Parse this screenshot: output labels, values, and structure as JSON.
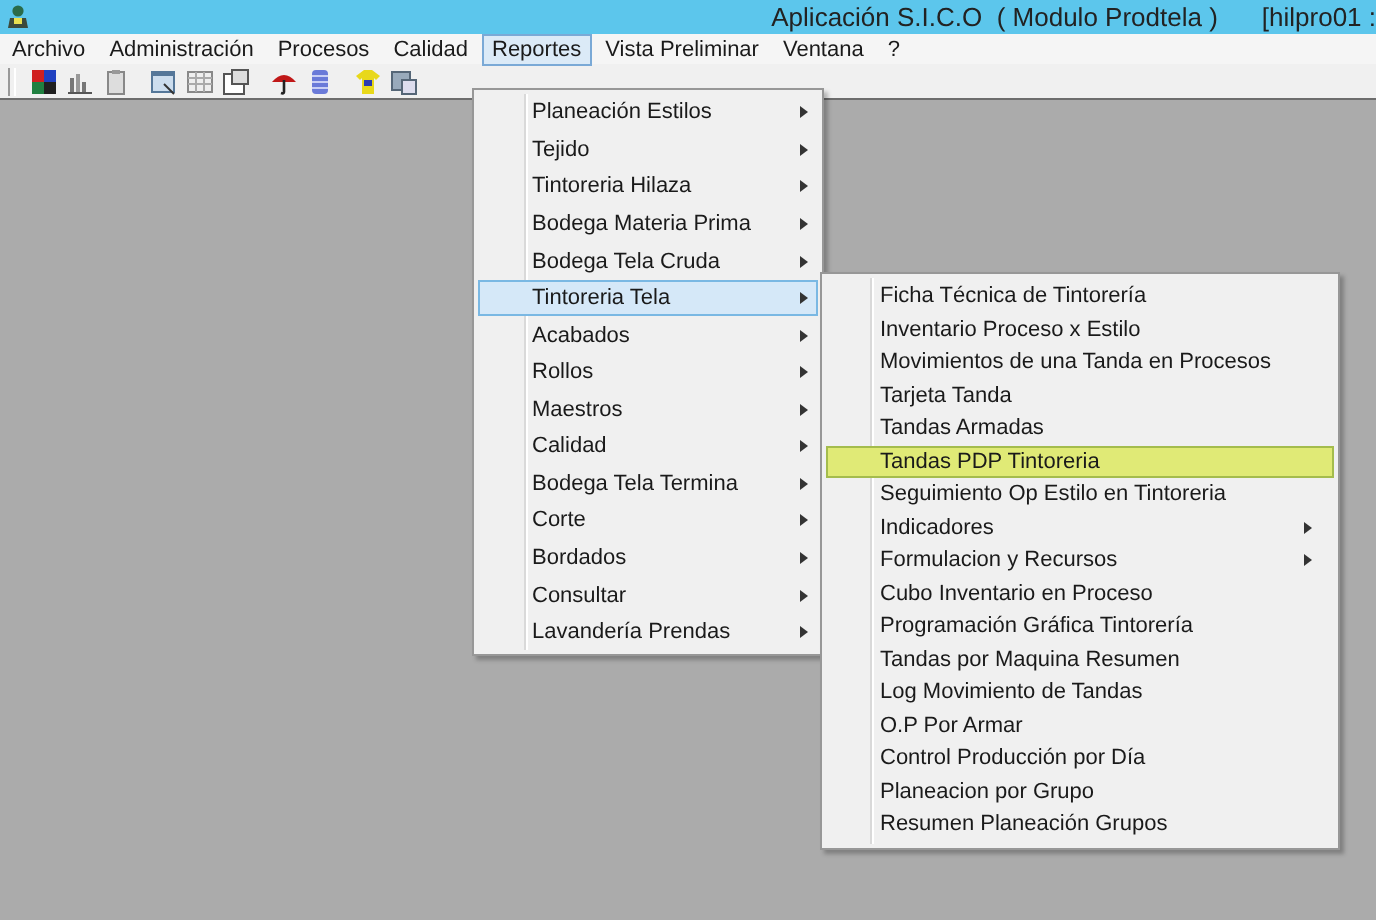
{
  "window": {
    "title": "Aplicación S.I.C.O  ( Modulo Prodtela )",
    "title_extra": "[hilpro01 :"
  },
  "menu_bar": [
    {
      "label": "Archivo",
      "selected": false
    },
    {
      "label": "Administración",
      "selected": false
    },
    {
      "label": "Procesos",
      "selected": false
    },
    {
      "label": "Calidad",
      "selected": false
    },
    {
      "label": "Reportes",
      "selected": true
    },
    {
      "label": "Vista Preliminar",
      "selected": false
    },
    {
      "label": "Ventana",
      "selected": false
    },
    {
      "label": "?",
      "selected": false
    }
  ],
  "reportes_menu": {
    "items": [
      {
        "label": "Planeación Estilos",
        "has_submenu": true,
        "selected": false
      },
      {
        "label": "Tejido",
        "has_submenu": true,
        "selected": false
      },
      {
        "label": "Tintoreria Hilaza",
        "has_submenu": true,
        "selected": false
      },
      {
        "label": "Bodega Materia Prima",
        "has_submenu": true,
        "selected": false
      },
      {
        "label": "Bodega Tela Cruda",
        "has_submenu": true,
        "selected": false
      },
      {
        "label": "Tintoreria Tela",
        "has_submenu": true,
        "selected": true
      },
      {
        "label": "Acabados",
        "has_submenu": true,
        "selected": false
      },
      {
        "label": "Rollos",
        "has_submenu": true,
        "selected": false
      },
      {
        "label": "Maestros",
        "has_submenu": true,
        "selected": false
      },
      {
        "label": "Calidad",
        "has_submenu": true,
        "selected": false
      },
      {
        "label": "Bodega Tela Termina",
        "has_submenu": true,
        "selected": false
      },
      {
        "label": "Corte",
        "has_submenu": true,
        "selected": false
      },
      {
        "label": "Bordados",
        "has_submenu": true,
        "selected": false
      },
      {
        "label": "Consultar",
        "has_submenu": true,
        "selected": false
      },
      {
        "label": "Lavandería Prendas",
        "has_submenu": true,
        "selected": false
      }
    ]
  },
  "tintoreria_tela_submenu": {
    "items": [
      {
        "label": "Ficha Técnica de Tintorería",
        "has_submenu": false,
        "selected": false
      },
      {
        "label": "Inventario Proceso x Estilo",
        "has_submenu": false,
        "selected": false
      },
      {
        "label": "Movimientos de una Tanda en Procesos",
        "has_submenu": false,
        "selected": false
      },
      {
        "label": "Tarjeta Tanda",
        "has_submenu": false,
        "selected": false
      },
      {
        "label": "Tandas Armadas",
        "has_submenu": false,
        "selected": false
      },
      {
        "label": "Tandas PDP Tintoreria",
        "has_submenu": false,
        "selected": true
      },
      {
        "label": "Seguimiento Op Estilo en Tintoreria",
        "has_submenu": false,
        "selected": false
      },
      {
        "label": "Indicadores",
        "has_submenu": true,
        "selected": false
      },
      {
        "label": "Formulacion y Recursos",
        "has_submenu": true,
        "selected": false
      },
      {
        "label": "Cubo Inventario en Proceso",
        "has_submenu": false,
        "selected": false
      },
      {
        "label": "Programación Gráfica Tintorería",
        "has_submenu": false,
        "selected": false
      },
      {
        "label": "Tandas por Maquina Resumen",
        "has_submenu": false,
        "selected": false
      },
      {
        "label": "Log Movimiento de Tandas",
        "has_submenu": false,
        "selected": false
      },
      {
        "label": "O.P Por Armar",
        "has_submenu": false,
        "selected": false
      },
      {
        "label": "Control Producción por Día",
        "has_submenu": false,
        "selected": false
      },
      {
        "label": "Planeacion por Grupo",
        "has_submenu": false,
        "selected": false
      },
      {
        "label": "Resumen Planeación Grupos",
        "has_submenu": false,
        "selected": false
      }
    ]
  }
}
